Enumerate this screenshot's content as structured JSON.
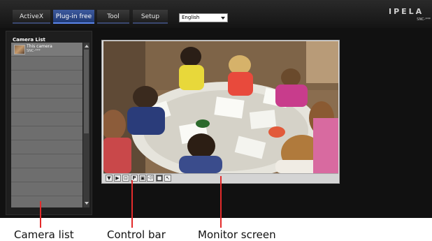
{
  "header": {
    "tabs": [
      {
        "label": "ActiveX",
        "active": false
      },
      {
        "label": "Plug-in free",
        "active": true
      },
      {
        "label": "Tool",
        "active": false
      },
      {
        "label": "Setup",
        "active": false
      }
    ],
    "language": {
      "selected": "English"
    },
    "logo_text": "IPELA",
    "model": "SNC-***"
  },
  "camera_list": {
    "title": "Camera List",
    "items": [
      {
        "name": "This camera",
        "model": "SNC-***"
      }
    ]
  },
  "control_bar": {
    "buttons": [
      {
        "icon": "down-arrow-icon",
        "glyph": "▼"
      },
      {
        "icon": "play-icon",
        "glyph": "▶"
      },
      {
        "icon": "zoom-icon",
        "glyph": "⊡"
      },
      {
        "icon": "preset-icon",
        "glyph": "P"
      },
      {
        "icon": "capture-icon",
        "glyph": "▣"
      },
      {
        "icon": "audio-icon",
        "glyph": "◁)"
      },
      {
        "icon": "full-screen-icon",
        "glyph": "■"
      },
      {
        "icon": "pointer-icon",
        "glyph": "↖"
      }
    ]
  },
  "callouts": {
    "camera_list": "Camera list",
    "control_bar": "Control bar",
    "monitor_screen": "Monitor screen"
  },
  "colors": {
    "active_tab": "#2f4d94",
    "callout_line": "#e32b2b",
    "background": "#111111"
  }
}
